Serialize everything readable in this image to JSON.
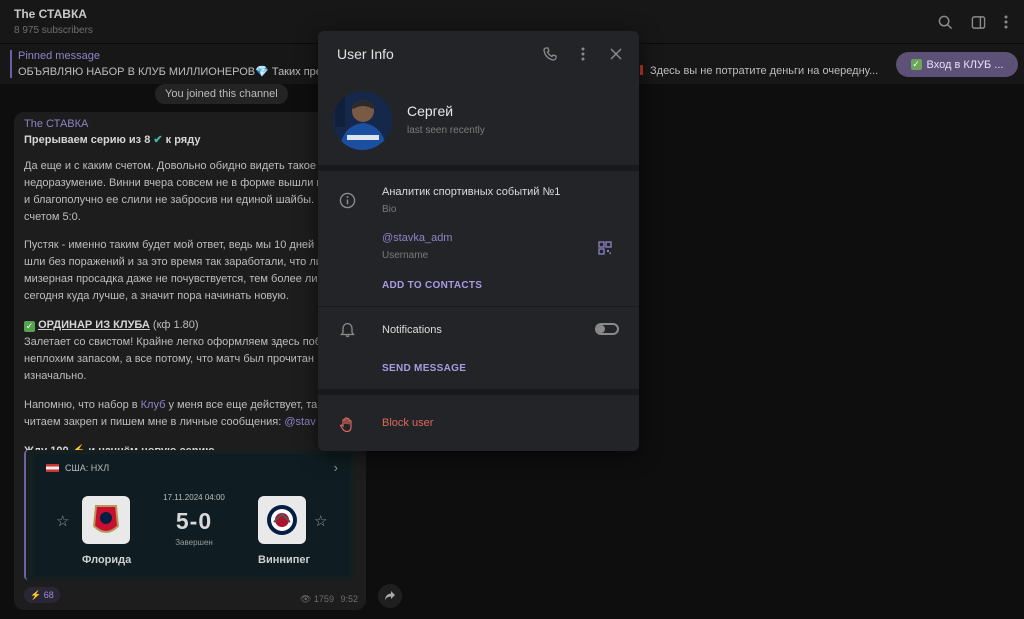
{
  "header": {
    "channel_title": "The СТАВКА",
    "subscribers": "8 975 subscribers"
  },
  "pinned": {
    "title": "Pinned message",
    "text": "ОБЪЯВЛЯЮ НАБОР В КЛУБ МИЛЛИОНЕРОВ💎  Таких пред",
    "right_text": "Здесь вы не потратите деньги на очередну...",
    "club_button": "Вход в КЛУБ ..."
  },
  "chat": {
    "joined_notice": "You joined this channel",
    "message": {
      "from": "The СТАВКА",
      "headline_a": "Прерываем серию из 8",
      "headline_b": "к ряду",
      "p1": [
        "Да еще и с каким счетом. Довольно обидно видеть такое",
        "недоразумение. Винни вчера совсем не в форме вышли н",
        "и благополучно ее слили не забросив ни единой шайбы.",
        "счетом 5:0."
      ],
      "p2": [
        "Пустяк - именно таким будет мой ответ, ведь мы 10 дней и",
        "шли без поражений и за это время так заработали, что ли",
        "мизерная просадка даже не почувствуется, тем более лин",
        "сегодня куда лучше, а значит пора начинать новую."
      ],
      "bet_title": "ОРДИНАР ИЗ КЛУБА",
      "bet_odds": "(кф 1.80)",
      "p3": [
        "Залетает со свистом! Крайне легко оформляем здесь побе",
        "неплохим запасом, а все потому, что матч был прочитан",
        "изначально."
      ],
      "p4a_pre": "Напомню, что набор в ",
      "p4a_link": "Клуб",
      "p4a_post": " у меня все еще действует, та",
      "p4b_pre": "читаем закреп и пишем мне в личные сообщения: ",
      "p4b_link": "@stav",
      "closing_a": "Жду 100",
      "closing_b": "и начнём новую серию",
      "card": {
        "league": "США: НХЛ",
        "date": "17.11.2024 04:00",
        "score": "5-0",
        "status": "Завершен",
        "home": "Флорида",
        "away": "Виннипег"
      },
      "reaction": "⚡ 68",
      "views": "1759",
      "time": "9:52"
    }
  },
  "modal": {
    "title": "User Info",
    "name": "Сергей",
    "last_seen": "last seen recently",
    "bio": "Аналитик спортивных событий №1",
    "bio_label": "Bio",
    "username": "@stavka_adm",
    "username_label": "Username",
    "add_to_contacts": "ADD TO CONTACTS",
    "notifications": "Notifications",
    "send_message": "SEND MESSAGE",
    "block_user": "Block user"
  }
}
